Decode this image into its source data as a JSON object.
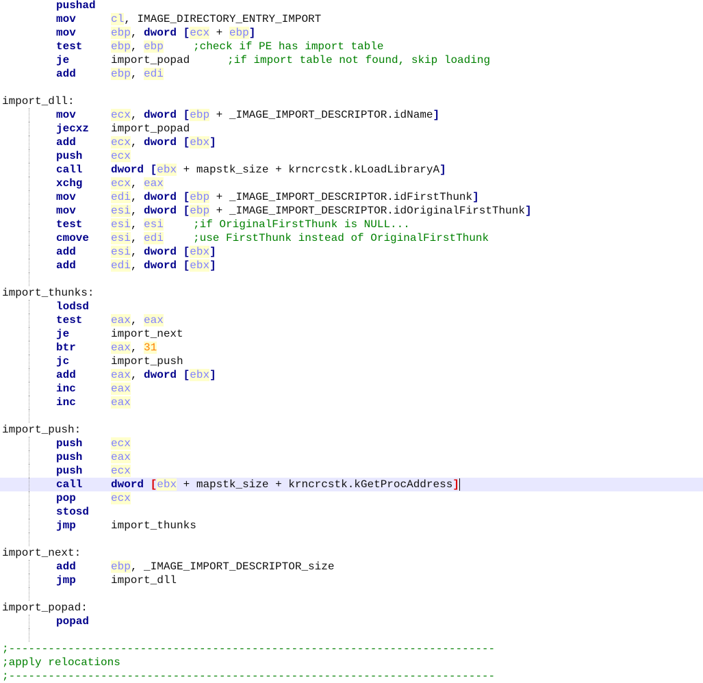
{
  "editor": {
    "lines": [
      {
        "mnemonic": "pushad"
      },
      {
        "mnemonic": "mov",
        "operands": [
          {
            "t": "r",
            "v": "cl"
          },
          {
            "t": "p",
            "v": ", IMAGE_DIRECTORY_ENTRY_IMPORT"
          }
        ]
      },
      {
        "mnemonic": "mov",
        "operands": [
          {
            "t": "r",
            "v": "ebp"
          },
          {
            "t": "p",
            "v": ", "
          },
          {
            "t": "k",
            "v": "dword"
          },
          {
            "t": "p",
            "v": " "
          },
          {
            "t": "b",
            "v": "["
          },
          {
            "t": "r",
            "v": "ecx"
          },
          {
            "t": "p",
            "v": " + "
          },
          {
            "t": "r",
            "v": "ebp"
          },
          {
            "t": "b",
            "v": "]"
          }
        ]
      },
      {
        "mnemonic": "test",
        "operands": [
          {
            "t": "r",
            "v": "ebp"
          },
          {
            "t": "p",
            "v": ", "
          },
          {
            "t": "r",
            "v": "ebp"
          }
        ],
        "comment": ";check if PE has import table",
        "comment_col": 282
      },
      {
        "mnemonic": "je",
        "operands": [
          {
            "t": "p",
            "v": "import_popad"
          }
        ],
        "comment": ";if import table not found, skip loading",
        "comment_col": 332
      },
      {
        "mnemonic": "add",
        "operands": [
          {
            "t": "r",
            "v": "ebp"
          },
          {
            "t": "p",
            "v": ", "
          },
          {
            "t": "r",
            "v": "edi"
          }
        ]
      },
      {
        "blank": true
      },
      {
        "label": "import_dll:"
      },
      {
        "mnemonic": "mov",
        "operands": [
          {
            "t": "r",
            "v": "ecx"
          },
          {
            "t": "p",
            "v": ", "
          },
          {
            "t": "k",
            "v": "dword"
          },
          {
            "t": "p",
            "v": " "
          },
          {
            "t": "b",
            "v": "["
          },
          {
            "t": "r",
            "v": "ebp"
          },
          {
            "t": "p",
            "v": " + _IMAGE_IMPORT_DESCRIPTOR.idName"
          },
          {
            "t": "b",
            "v": "]"
          }
        ]
      },
      {
        "mnemonic": "jecxz",
        "operands": [
          {
            "t": "p",
            "v": "import_popad"
          }
        ]
      },
      {
        "mnemonic": "add",
        "operands": [
          {
            "t": "r",
            "v": "ecx"
          },
          {
            "t": "p",
            "v": ", "
          },
          {
            "t": "k",
            "v": "dword"
          },
          {
            "t": "p",
            "v": " "
          },
          {
            "t": "b",
            "v": "["
          },
          {
            "t": "r",
            "v": "ebx"
          },
          {
            "t": "b",
            "v": "]"
          }
        ]
      },
      {
        "mnemonic": "push",
        "operands": [
          {
            "t": "r",
            "v": "ecx"
          }
        ]
      },
      {
        "mnemonic": "call",
        "operands": [
          {
            "t": "k",
            "v": "dword"
          },
          {
            "t": "p",
            "v": " "
          },
          {
            "t": "b",
            "v": "["
          },
          {
            "t": "r",
            "v": "ebx"
          },
          {
            "t": "p",
            "v": " + mapstk_size + krncrcstk.kLoadLibraryA"
          },
          {
            "t": "b",
            "v": "]"
          }
        ]
      },
      {
        "mnemonic": "xchg",
        "operands": [
          {
            "t": "r",
            "v": "ecx"
          },
          {
            "t": "p",
            "v": ", "
          },
          {
            "t": "r",
            "v": "eax"
          }
        ]
      },
      {
        "mnemonic": "mov",
        "operands": [
          {
            "t": "r",
            "v": "edi"
          },
          {
            "t": "p",
            "v": ", "
          },
          {
            "t": "k",
            "v": "dword"
          },
          {
            "t": "p",
            "v": " "
          },
          {
            "t": "b",
            "v": "["
          },
          {
            "t": "r",
            "v": "ebp"
          },
          {
            "t": "p",
            "v": " + _IMAGE_IMPORT_DESCRIPTOR.idFirstThunk"
          },
          {
            "t": "b",
            "v": "]"
          }
        ]
      },
      {
        "mnemonic": "mov",
        "operands": [
          {
            "t": "r",
            "v": "esi"
          },
          {
            "t": "p",
            "v": ", "
          },
          {
            "t": "k",
            "v": "dword"
          },
          {
            "t": "p",
            "v": " "
          },
          {
            "t": "b",
            "v": "["
          },
          {
            "t": "r",
            "v": "ebp"
          },
          {
            "t": "p",
            "v": " + _IMAGE_IMPORT_DESCRIPTOR.idOriginalFirstThunk"
          },
          {
            "t": "b",
            "v": "]"
          }
        ]
      },
      {
        "mnemonic": "test",
        "operands": [
          {
            "t": "r",
            "v": "esi"
          },
          {
            "t": "p",
            "v": ", "
          },
          {
            "t": "r",
            "v": "esi"
          }
        ],
        "comment": ";if OriginalFirstThunk is NULL...",
        "comment_col": 282
      },
      {
        "mnemonic": "cmove",
        "operands": [
          {
            "t": "r",
            "v": "esi"
          },
          {
            "t": "p",
            "v": ", "
          },
          {
            "t": "r",
            "v": "edi"
          }
        ],
        "comment": ";use FirstThunk instead of OriginalFirstThunk",
        "comment_col": 282
      },
      {
        "mnemonic": "add",
        "operands": [
          {
            "t": "r",
            "v": "esi"
          },
          {
            "t": "p",
            "v": ", "
          },
          {
            "t": "k",
            "v": "dword"
          },
          {
            "t": "p",
            "v": " "
          },
          {
            "t": "b",
            "v": "["
          },
          {
            "t": "r",
            "v": "ebx"
          },
          {
            "t": "b",
            "v": "]"
          }
        ]
      },
      {
        "mnemonic": "add",
        "operands": [
          {
            "t": "r",
            "v": "edi"
          },
          {
            "t": "p",
            "v": ", "
          },
          {
            "t": "k",
            "v": "dword"
          },
          {
            "t": "p",
            "v": " "
          },
          {
            "t": "b",
            "v": "["
          },
          {
            "t": "r",
            "v": "ebx"
          },
          {
            "t": "b",
            "v": "]"
          }
        ]
      },
      {
        "blank": true
      },
      {
        "label": "import_thunks:"
      },
      {
        "mnemonic": "lodsd"
      },
      {
        "mnemonic": "test",
        "operands": [
          {
            "t": "r",
            "v": "eax"
          },
          {
            "t": "p",
            "v": ", "
          },
          {
            "t": "r",
            "v": "eax"
          }
        ]
      },
      {
        "mnemonic": "je",
        "operands": [
          {
            "t": "p",
            "v": "import_next"
          }
        ]
      },
      {
        "mnemonic": "btr",
        "operands": [
          {
            "t": "r",
            "v": "eax"
          },
          {
            "t": "p",
            "v": ", "
          },
          {
            "t": "n",
            "v": "31"
          }
        ]
      },
      {
        "mnemonic": "jc",
        "operands": [
          {
            "t": "p",
            "v": "import_push"
          }
        ]
      },
      {
        "mnemonic": "add",
        "operands": [
          {
            "t": "r",
            "v": "eax"
          },
          {
            "t": "p",
            "v": ", "
          },
          {
            "t": "k",
            "v": "dword"
          },
          {
            "t": "p",
            "v": " "
          },
          {
            "t": "b",
            "v": "["
          },
          {
            "t": "r",
            "v": "ebx"
          },
          {
            "t": "b",
            "v": "]"
          }
        ]
      },
      {
        "mnemonic": "inc",
        "operands": [
          {
            "t": "r",
            "v": "eax"
          }
        ]
      },
      {
        "mnemonic": "inc",
        "operands": [
          {
            "t": "r",
            "v": "eax"
          }
        ]
      },
      {
        "blank": true
      },
      {
        "label": "import_push:"
      },
      {
        "mnemonic": "push",
        "operands": [
          {
            "t": "r",
            "v": "ecx"
          }
        ]
      },
      {
        "mnemonic": "push",
        "operands": [
          {
            "t": "r",
            "v": "eax"
          }
        ]
      },
      {
        "mnemonic": "push",
        "operands": [
          {
            "t": "r",
            "v": "ecx"
          }
        ]
      },
      {
        "mnemonic": "call",
        "current": true,
        "operands": [
          {
            "t": "k",
            "v": "dword"
          },
          {
            "t": "p",
            "v": " "
          },
          {
            "t": "bh",
            "v": "["
          },
          {
            "t": "r",
            "v": "ebx"
          },
          {
            "t": "p",
            "v": " + mapstk_size + krncrcstk.kGetProcAddress"
          },
          {
            "t": "bh",
            "v": "]"
          },
          {
            "t": "c",
            "v": ""
          }
        ]
      },
      {
        "mnemonic": "pop",
        "operands": [
          {
            "t": "r",
            "v": "ecx"
          }
        ]
      },
      {
        "mnemonic": "stosd"
      },
      {
        "mnemonic": "jmp",
        "operands": [
          {
            "t": "p",
            "v": "import_thunks"
          }
        ]
      },
      {
        "blank": true
      },
      {
        "label": "import_next:"
      },
      {
        "mnemonic": "add",
        "operands": [
          {
            "t": "r",
            "v": "ebp"
          },
          {
            "t": "p",
            "v": ", _IMAGE_IMPORT_DESCRIPTOR_size"
          }
        ]
      },
      {
        "mnemonic": "jmp",
        "operands": [
          {
            "t": "p",
            "v": "import_dll"
          }
        ]
      },
      {
        "blank": true
      },
      {
        "label": "import_popad:"
      },
      {
        "mnemonic": "popad"
      },
      {
        "blank": true
      },
      {
        "full_comment": ";--------------------------------------------------------------------------"
      },
      {
        "full_comment": ";apply relocations"
      },
      {
        "full_comment": ";--------------------------------------------------------------------------"
      }
    ]
  }
}
